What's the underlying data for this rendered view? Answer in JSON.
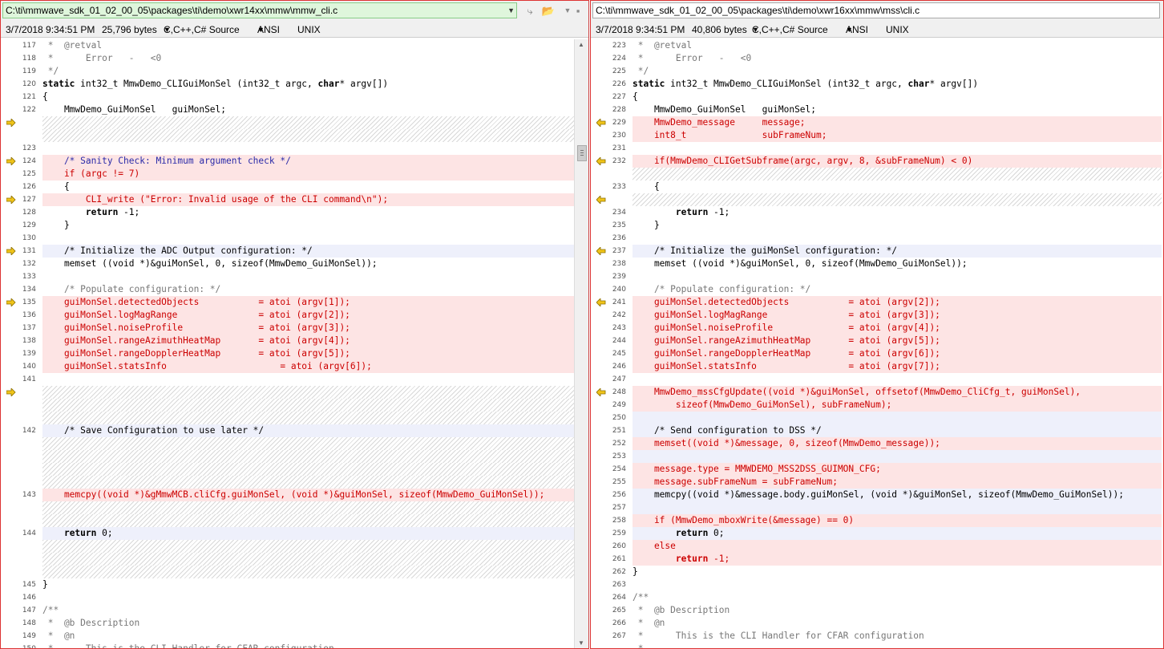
{
  "left": {
    "path": "C:\\ti\\mmwave_sdk_01_02_00_05\\packages\\ti\\demo\\xwr14xx\\mmw\\mmw_cli.c",
    "date": "3/7/2018 9:34:51 PM",
    "size": "25,796 bytes",
    "format": "C,C++,C# Source",
    "encoding": "ANSI",
    "eol": "UNIX",
    "rows": [
      {
        "ln": "117",
        "t": " *  @retval",
        "s": "cm"
      },
      {
        "ln": "118",
        "t": " *      Error   -   <0",
        "s": "cm"
      },
      {
        "ln": "119",
        "t": " */",
        "s": "cm"
      },
      {
        "ln": "120",
        "t": "static int32_t MmwDemo_CLIGuiMonSel (int32_t argc, char* argv[])",
        "s": "n"
      },
      {
        "ln": "121",
        "t": "{",
        "s": "n"
      },
      {
        "ln": "122",
        "t": "    MmwDemo_GuiMonSel   guiMonSel;",
        "s": "n"
      },
      {
        "ln": "",
        "t": "",
        "s": "hatch",
        "arrow": true
      },
      {
        "ln": "",
        "t": "",
        "s": "hatch"
      },
      {
        "ln": "123",
        "t": "",
        "s": "n"
      },
      {
        "ln": "124",
        "t": "    /* Sanity Check: Minimum argument check */",
        "s": "diff-c",
        "arrow": true
      },
      {
        "ln": "125",
        "t": "    if (argc != 7)",
        "s": "diff"
      },
      {
        "ln": "126",
        "t": "    {",
        "s": "n"
      },
      {
        "ln": "127",
        "t": "        CLI_write (\"Error: Invalid usage of the CLI command\\n\");",
        "s": "diff",
        "arrow": true
      },
      {
        "ln": "128",
        "t": "        return -1;",
        "s": "n"
      },
      {
        "ln": "129",
        "t": "    }",
        "s": "n"
      },
      {
        "ln": "130",
        "t": "",
        "s": "n"
      },
      {
        "ln": "131",
        "t": "    /* Initialize the ADC Output configuration: */",
        "s": "info",
        "arrow": true
      },
      {
        "ln": "132",
        "t": "    memset ((void *)&guiMonSel, 0, sizeof(MmwDemo_GuiMonSel));",
        "s": "n"
      },
      {
        "ln": "133",
        "t": "",
        "s": "n"
      },
      {
        "ln": "134",
        "t": "    /* Populate configuration: */",
        "s": "cm"
      },
      {
        "ln": "135",
        "t": "    guiMonSel.detectedObjects           = atoi (argv[1]);",
        "s": "diff",
        "arrow": true
      },
      {
        "ln": "136",
        "t": "    guiMonSel.logMagRange               = atoi (argv[2]);",
        "s": "diff"
      },
      {
        "ln": "137",
        "t": "    guiMonSel.noiseProfile              = atoi (argv[3]);",
        "s": "diff"
      },
      {
        "ln": "138",
        "t": "    guiMonSel.rangeAzimuthHeatMap       = atoi (argv[4]);",
        "s": "diff"
      },
      {
        "ln": "139",
        "t": "    guiMonSel.rangeDopplerHeatMap       = atoi (argv[5]);",
        "s": "diff"
      },
      {
        "ln": "140",
        "t": "    guiMonSel.statsInfo                     = atoi (argv[6]);",
        "s": "diff"
      },
      {
        "ln": "141",
        "t": "",
        "s": "n"
      },
      {
        "ln": "",
        "t": "",
        "s": "hatch",
        "arrow": true
      },
      {
        "ln": "",
        "t": "",
        "s": "hatch"
      },
      {
        "ln": "",
        "t": "",
        "s": "hatch"
      },
      {
        "ln": "142",
        "t": "    /* Save Configuration to use later */",
        "s": "info"
      },
      {
        "ln": "",
        "t": "",
        "s": "hatch"
      },
      {
        "ln": "",
        "t": "",
        "s": "hatch"
      },
      {
        "ln": "",
        "t": "",
        "s": "hatch"
      },
      {
        "ln": "",
        "t": "",
        "s": "hatch"
      },
      {
        "ln": "143",
        "t": "    memcpy((void *)&gMmwMCB.cliCfg.guiMonSel, (void *)&guiMonSel, sizeof(MmwDemo_GuiMonSel));",
        "s": "diff"
      },
      {
        "ln": "",
        "t": "",
        "s": "hatch"
      },
      {
        "ln": "",
        "t": "",
        "s": "hatch"
      },
      {
        "ln": "144",
        "t": "    return 0;",
        "s": "info"
      },
      {
        "ln": "",
        "t": "",
        "s": "hatch"
      },
      {
        "ln": "",
        "t": "",
        "s": "hatch"
      },
      {
        "ln": "",
        "t": "",
        "s": "hatch"
      },
      {
        "ln": "145",
        "t": "}",
        "s": "n"
      },
      {
        "ln": "146",
        "t": "",
        "s": "n"
      },
      {
        "ln": "147",
        "t": "/**",
        "s": "cm"
      },
      {
        "ln": "148",
        "t": " *  @b Description",
        "s": "cm"
      },
      {
        "ln": "149",
        "t": " *  @n",
        "s": "cm"
      },
      {
        "ln": "150",
        "t": " *      This is the CLI Handler for CFAR configuration",
        "s": "cm"
      },
      {
        "ln": "",
        "t": " *",
        "s": "cm"
      }
    ]
  },
  "right": {
    "path": "C:\\ti\\mmwave_sdk_01_02_00_05\\packages\\ti\\demo\\xwr16xx\\mmw\\mss\\cli.c",
    "date": "3/7/2018 9:34:51 PM",
    "size": "40,806 bytes",
    "format": "C,C++,C# Source",
    "encoding": "ANSI",
    "eol": "UNIX",
    "rows": [
      {
        "ln": "223",
        "t": " *  @retval",
        "s": "cm"
      },
      {
        "ln": "224",
        "t": " *      Error   -   <0",
        "s": "cm"
      },
      {
        "ln": "225",
        "t": " */",
        "s": "cm"
      },
      {
        "ln": "226",
        "t": "static int32_t MmwDemo_CLIGuiMonSel (int32_t argc, char* argv[])",
        "s": "n"
      },
      {
        "ln": "227",
        "t": "{",
        "s": "n"
      },
      {
        "ln": "228",
        "t": "    MmwDemo_GuiMonSel   guiMonSel;",
        "s": "n"
      },
      {
        "ln": "229",
        "t": "    MmwDemo_message     message;",
        "s": "diff",
        "arrow": true
      },
      {
        "ln": "230",
        "t": "    int8_t              subFrameNum;",
        "s": "diff"
      },
      {
        "ln": "231",
        "t": "",
        "s": "n"
      },
      {
        "ln": "232",
        "t": "    if(MmwDemo_CLIGetSubframe(argc, argv, 8, &subFrameNum) < 0)",
        "s": "diff",
        "arrow": true
      },
      {
        "ln": "",
        "t": "",
        "s": "hatch"
      },
      {
        "ln": "233",
        "t": "    {",
        "s": "n"
      },
      {
        "ln": "",
        "t": "",
        "s": "hatch",
        "arrow": true
      },
      {
        "ln": "234",
        "t": "        return -1;",
        "s": "n"
      },
      {
        "ln": "235",
        "t": "    }",
        "s": "n"
      },
      {
        "ln": "236",
        "t": "",
        "s": "n"
      },
      {
        "ln": "237",
        "t": "    /* Initialize the guiMonSel configuration: */",
        "s": "info",
        "arrow": true
      },
      {
        "ln": "238",
        "t": "    memset ((void *)&guiMonSel, 0, sizeof(MmwDemo_GuiMonSel));",
        "s": "n"
      },
      {
        "ln": "239",
        "t": "",
        "s": "n"
      },
      {
        "ln": "240",
        "t": "    /* Populate configuration: */",
        "s": "cm"
      },
      {
        "ln": "241",
        "t": "    guiMonSel.detectedObjects           = atoi (argv[2]);",
        "s": "diff",
        "arrow": true
      },
      {
        "ln": "242",
        "t": "    guiMonSel.logMagRange               = atoi (argv[3]);",
        "s": "diff"
      },
      {
        "ln": "243",
        "t": "    guiMonSel.noiseProfile              = atoi (argv[4]);",
        "s": "diff"
      },
      {
        "ln": "244",
        "t": "    guiMonSel.rangeAzimuthHeatMap       = atoi (argv[5]);",
        "s": "diff"
      },
      {
        "ln": "245",
        "t": "    guiMonSel.rangeDopplerHeatMap       = atoi (argv[6]);",
        "s": "diff"
      },
      {
        "ln": "246",
        "t": "    guiMonSel.statsInfo                 = atoi (argv[7]);",
        "s": "diff"
      },
      {
        "ln": "247",
        "t": "",
        "s": "n"
      },
      {
        "ln": "248",
        "t": "    MmwDemo_mssCfgUpdate((void *)&guiMonSel, offsetof(MmwDemo_CliCfg_t, guiMonSel),",
        "s": "diff",
        "arrow": true
      },
      {
        "ln": "249",
        "t": "        sizeof(MmwDemo_GuiMonSel), subFrameNum);",
        "s": "diff"
      },
      {
        "ln": "250",
        "t": "",
        "s": "info"
      },
      {
        "ln": "251",
        "t": "    /* Send configuration to DSS */",
        "s": "info"
      },
      {
        "ln": "252",
        "t": "    memset((void *)&message, 0, sizeof(MmwDemo_message));",
        "s": "diff"
      },
      {
        "ln": "253",
        "t": "",
        "s": "info"
      },
      {
        "ln": "254",
        "t": "    message.type = MMWDEMO_MSS2DSS_GUIMON_CFG;",
        "s": "diff"
      },
      {
        "ln": "255",
        "t": "    message.subFrameNum = subFrameNum;",
        "s": "diff"
      },
      {
        "ln": "256",
        "t": "    memcpy((void *)&message.body.guiMonSel, (void *)&guiMonSel, sizeof(MmwDemo_GuiMonSel));",
        "s": "info"
      },
      {
        "ln": "257",
        "t": "",
        "s": "info"
      },
      {
        "ln": "258",
        "t": "    if (MmwDemo_mboxWrite(&message) == 0)",
        "s": "diff"
      },
      {
        "ln": "259",
        "t": "        return 0;",
        "s": "info"
      },
      {
        "ln": "260",
        "t": "    else",
        "s": "diff"
      },
      {
        "ln": "261",
        "t": "        return -1;",
        "s": "diff"
      },
      {
        "ln": "262",
        "t": "}",
        "s": "n"
      },
      {
        "ln": "263",
        "t": "",
        "s": "n"
      },
      {
        "ln": "264",
        "t": "/**",
        "s": "cm"
      },
      {
        "ln": "265",
        "t": " *  @b Description",
        "s": "cm"
      },
      {
        "ln": "266",
        "t": " *  @n",
        "s": "cm"
      },
      {
        "ln": "267",
        "t": " *      This is the CLI Handler for CFAR configuration",
        "s": "cm"
      },
      {
        "ln": "",
        "t": " *",
        "s": "cm"
      }
    ]
  },
  "colors": {
    "diff_bg": "#fde4e4",
    "info_bg": "#eef0fb",
    "diff_text": "#c00",
    "arrow": "#f0c419"
  },
  "icons": [
    "dropdown-caret-icon",
    "copy-to-right-icon",
    "open-folder-icon",
    "save-icon",
    "diff-arrow-icon"
  ]
}
